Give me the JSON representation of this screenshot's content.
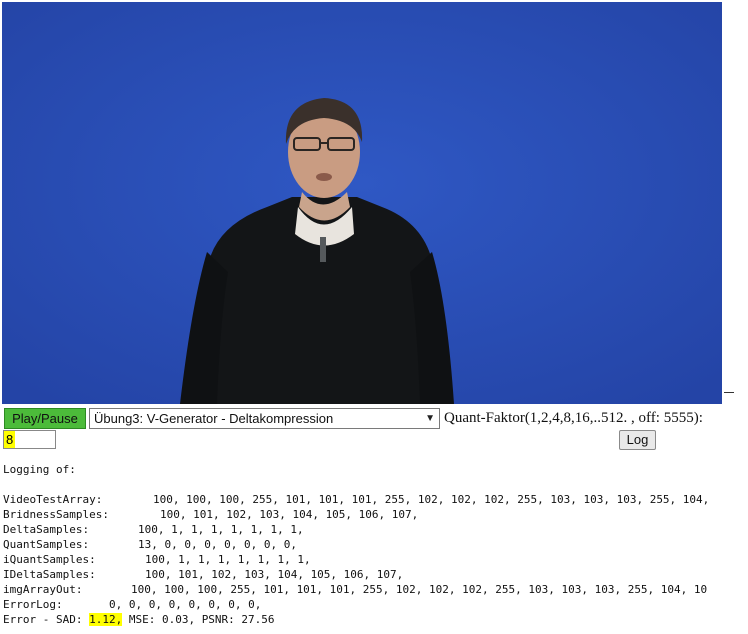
{
  "video": {
    "description_icon": "video-frame"
  },
  "controls": {
    "play_label": "Play/Pause",
    "select_value": "Übung3: V-Generator - Deltakompression",
    "quant_label": "Quant-Faktor(1,2,4,8,16,..512. , off: 5555):",
    "quant_value": "8",
    "log_label": "Log"
  },
  "log": {
    "header": "Logging of:",
    "rows": [
      {
        "label": "VideoTestArray:",
        "values": "100, 100, 100, 255, 101, 101, 101, 255, 102, 102, 102, 255, 103, 103, 103, 255, 104,"
      },
      {
        "label": "BridnessSamples:",
        "values": "100, 101, 102, 103, 104, 105, 106, 107,"
      },
      {
        "label": "DeltaSamples:",
        "values": "100, 1, 1, 1, 1, 1, 1, 1,"
      },
      {
        "label": "QuantSamples:",
        "values": "13, 0, 0, 0, 0, 0, 0, 0,"
      },
      {
        "label": "iQuantSamples:",
        "values": "100, 1, 1, 1, 1, 1, 1, 1,"
      },
      {
        "label": "IDeltaSamples:",
        "values": "100, 101, 102, 103, 104, 105, 106, 107,"
      },
      {
        "label": "imgArrayOut:",
        "values": "100, 100, 100, 255, 101, 101, 101, 255, 102, 102, 102, 255, 103, 103, 103, 255, 104, 10"
      },
      {
        "label": "ErrorLog:",
        "values": "0, 0, 0, 0, 0, 0, 0, 0,"
      }
    ],
    "error": {
      "prefix": "Error - SAD: ",
      "sad": "1.12,",
      "rest": " MSE: 0.03, PSNR: 27.56"
    }
  }
}
